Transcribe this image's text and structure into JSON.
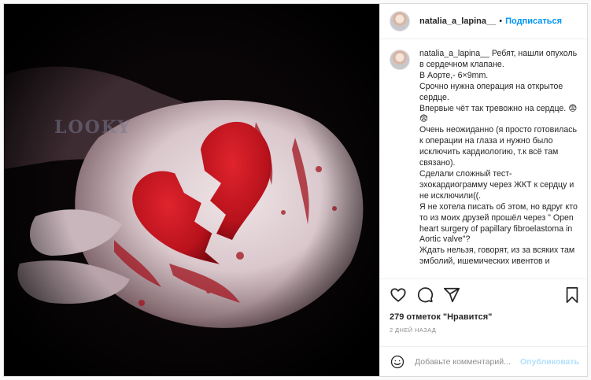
{
  "post": {
    "author": {
      "username": "natalia_a_lapina__",
      "follow_label": "Подписаться",
      "separator": "•"
    },
    "image": {
      "watermark_text": "LOOKY",
      "description_icon": "broken-heart-photo"
    },
    "caption": {
      "username": "natalia_a_lapina__",
      "lines": [
        "Ребят, нашли опухоль в сердечном клапане.",
        "В Аорте,- 6×9mm.",
        "Срочно нужна операция на открытое сердце.",
        "Впервые чёт так тревожно на сердце. 😨😨",
        "Очень неожиданно (я просто готовилась к операции на глаза и нужно было исключить кардиологию, т.к всё там связано).",
        "Сделали сложный тест-эхокардиограмму через ЖКТ к сердцу и не исключили((.",
        "Я не хотела писать об этом, но вдруг кто то из моих друзей прошёл через \" Open heart surgery of papillary fibroelastoma in Aortic valve\"?",
        "Ждать нельзя, говорят, из за всяких там эмболий, ишемических ивентов и"
      ]
    },
    "actions": {
      "like_icon": "heart-icon",
      "comment_icon": "comment-icon",
      "share_icon": "paper-plane-icon",
      "save_icon": "bookmark-icon"
    },
    "likes_text": "279 отметок \"Нравится\"",
    "timestamp": "2 ДНЕЙ НАЗАД",
    "add_comment": {
      "placeholder": "Добавьте комментарий...",
      "publish_label": "Опубликовать",
      "emoji_icon": "smiley-icon"
    }
  },
  "colors": {
    "accent": "#0095f6",
    "publish_disabled": "#b2dffc",
    "text": "#262626",
    "muted": "#8e8e8e",
    "border": "#dbdbdb"
  }
}
